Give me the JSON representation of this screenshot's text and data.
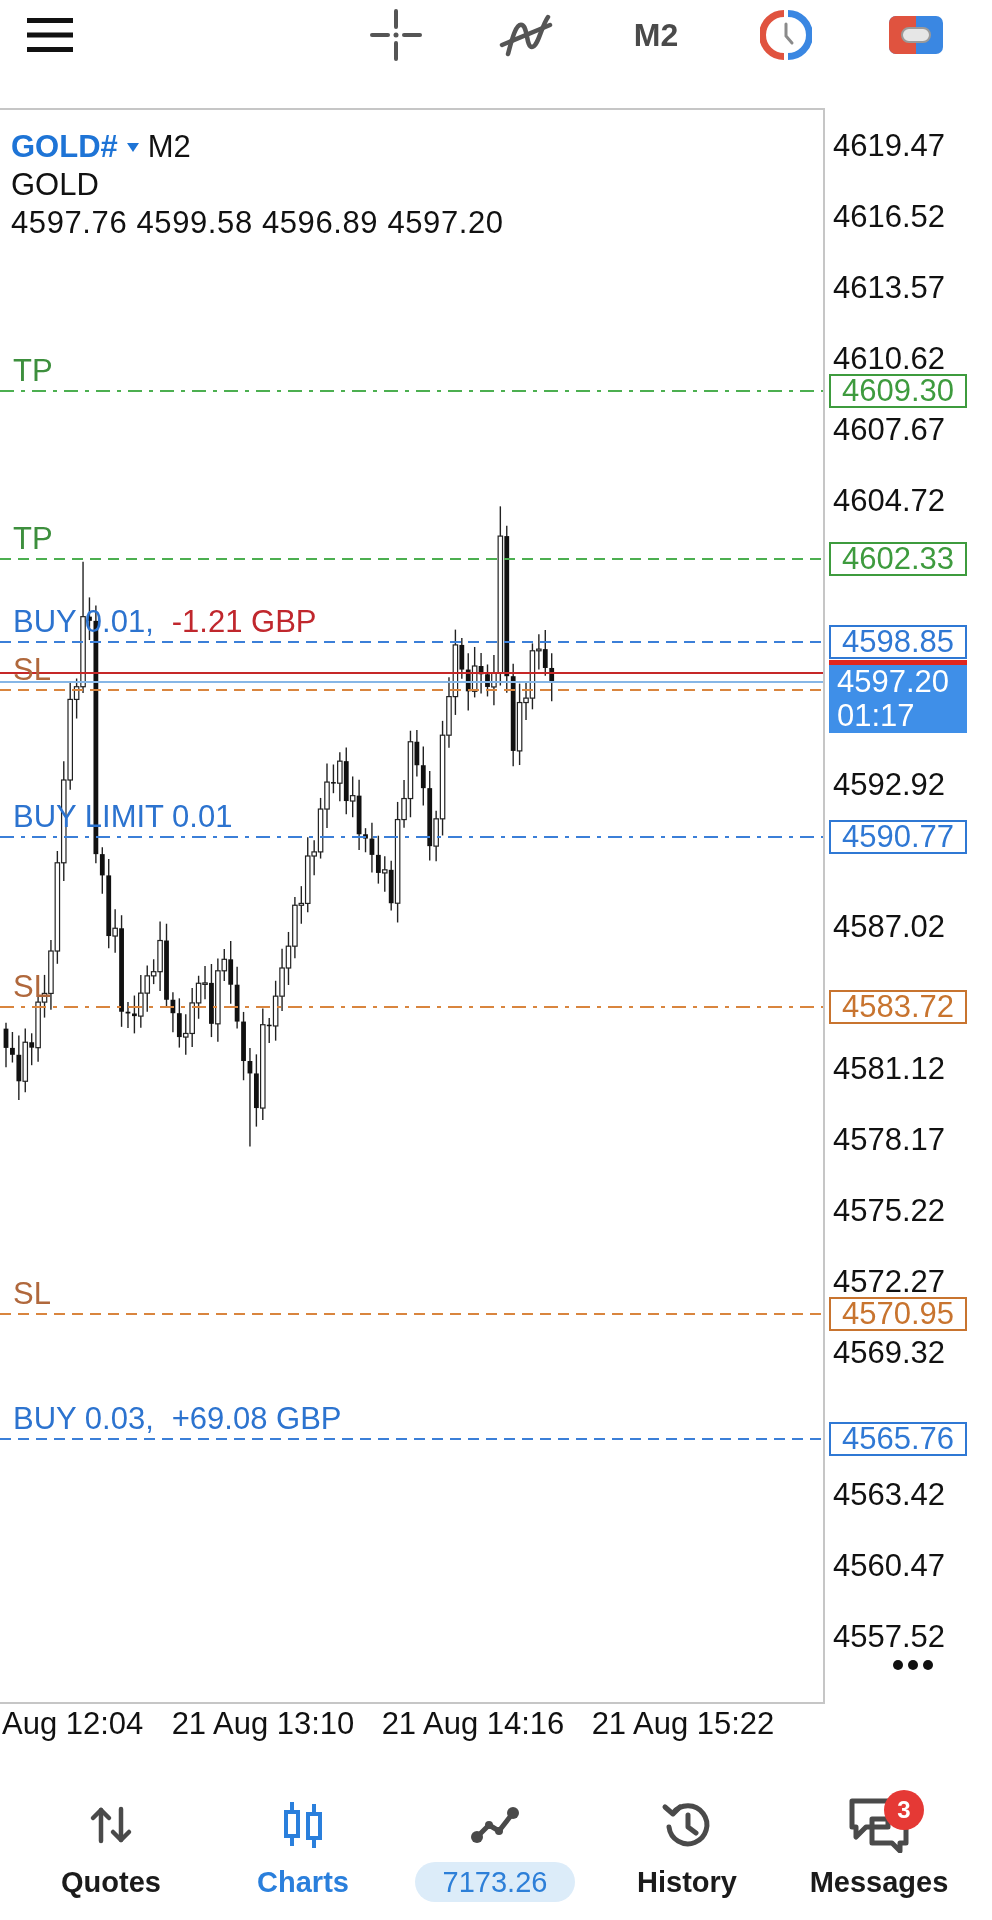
{
  "toolbar": {
    "timeframe": "M2"
  },
  "chart": {
    "symbol": "GOLD#",
    "timeframe": "M2",
    "description": "GOLD",
    "ohlc": "4597.76 4599.58 4596.89 4597.20",
    "price_axis": [
      "4619.47",
      "4616.52",
      "4613.57",
      "4610.62",
      "4607.67",
      "4604.72",
      "4592.92",
      "4587.02",
      "4581.12",
      "4578.17",
      "4575.22",
      "4572.27",
      "4569.32",
      "4563.42",
      "4560.47",
      "4557.52"
    ],
    "order_lines": [
      {
        "kind": "take_profit",
        "pending": true,
        "label": "TP",
        "price": "4609.30"
      },
      {
        "kind": "take_profit",
        "pending": false,
        "label": "TP",
        "price": "4602.33"
      },
      {
        "kind": "position",
        "pending": false,
        "label": "BUY 0.01,",
        "profit": "-1.21 GBP",
        "loss": true,
        "price": "4598.85"
      },
      {
        "kind": "stop_loss",
        "pending": false,
        "label": "SL"
      },
      {
        "kind": "pending_order",
        "pending": true,
        "label": "BUY LIMIT 0.01",
        "price": "4590.77"
      },
      {
        "kind": "stop_loss",
        "pending": true,
        "label": "SL",
        "price": "4583.72"
      },
      {
        "kind": "stop_loss",
        "pending": false,
        "label": "SL",
        "price": "4570.95"
      },
      {
        "kind": "position",
        "pending": false,
        "label": "BUY 0.03,",
        "profit": "+69.08 GBP",
        "loss": false,
        "price": "4565.76"
      }
    ],
    "current_price": {
      "bid": "4597.20",
      "countdown": "01:17"
    },
    "time_axis": [
      "Aug 12:04",
      "21 Aug 13:10",
      "21 Aug 14:16",
      "21 Aug 15:22"
    ]
  },
  "bottom_nav": [
    {
      "kind": "quotes",
      "label": "Quotes",
      "selected": false
    },
    {
      "kind": "charts",
      "label": "Charts",
      "selected": true
    },
    {
      "kind": "trade",
      "label": "7173.26",
      "selected": false
    },
    {
      "kind": "history",
      "label": "History",
      "selected": false
    },
    {
      "kind": "messages",
      "label": "Messages",
      "selected": false,
      "badge": "3"
    }
  ]
}
